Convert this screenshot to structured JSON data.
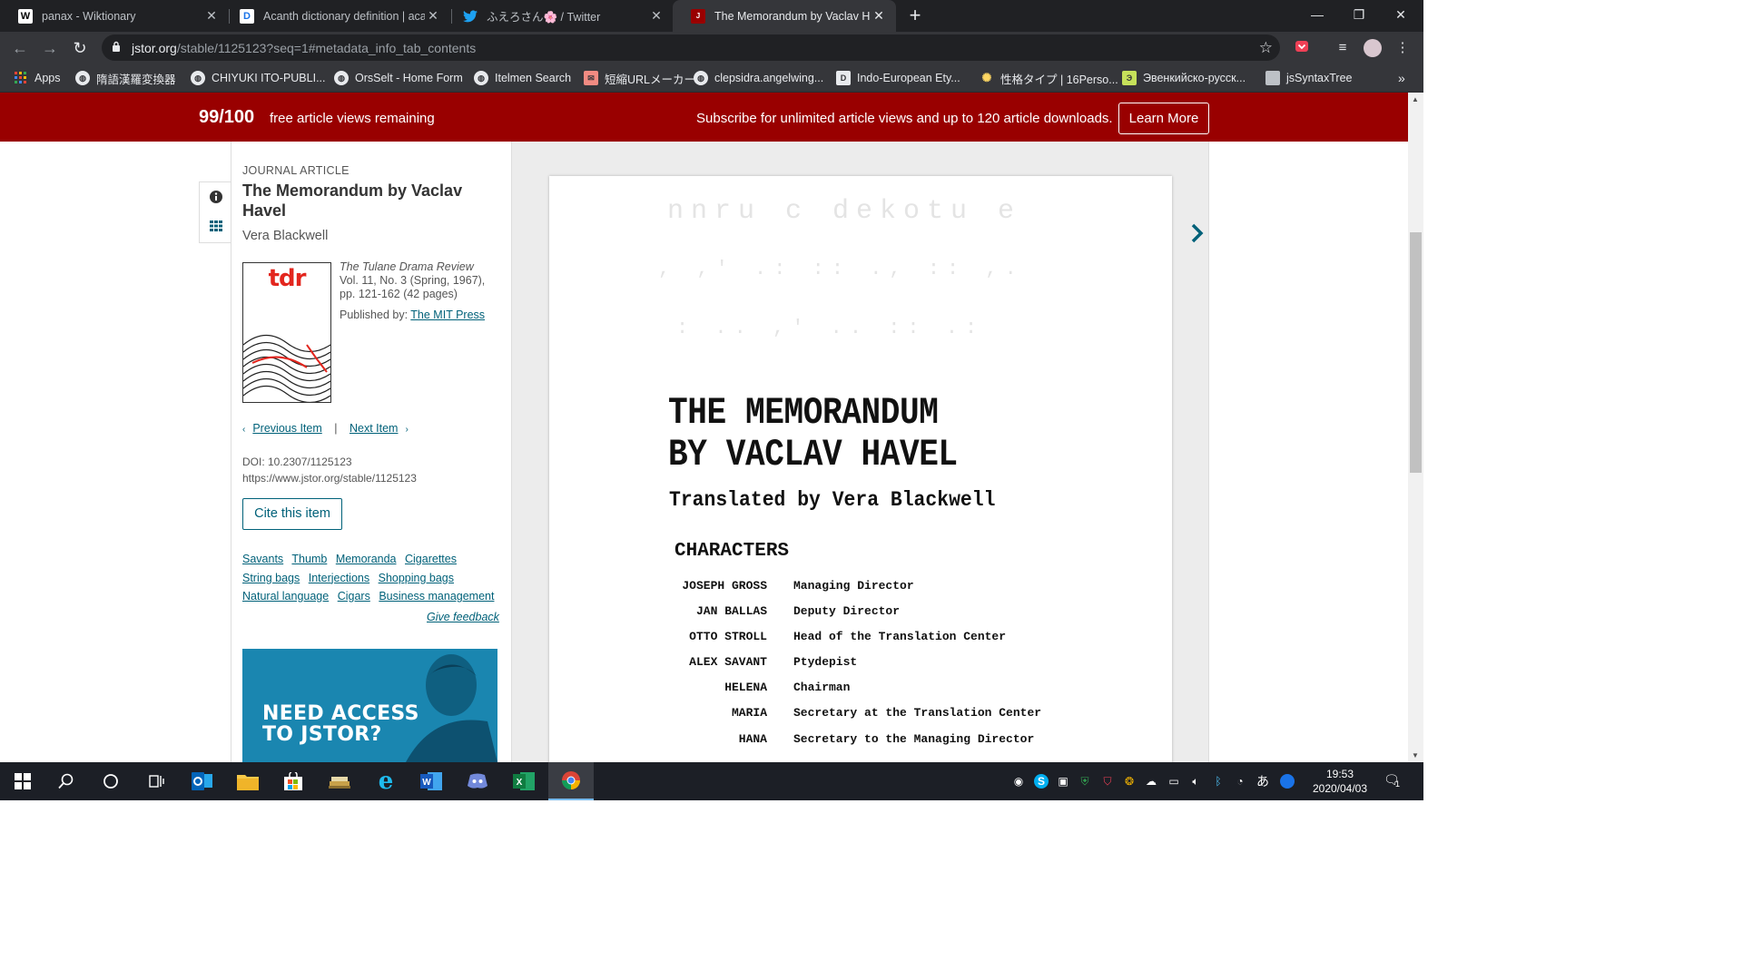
{
  "browser": {
    "tabs": [
      {
        "title": "panax - Wiktionary",
        "favicon": "W",
        "active": false
      },
      {
        "title": "Acanth dictionary definition | aca",
        "favicon": "D",
        "active": false
      },
      {
        "title": "ふえろさん🌸 / Twitter",
        "favicon": "twitter-bird",
        "active": false
      },
      {
        "title": "The Memorandum by Vaclav Hav",
        "favicon": "jstor",
        "active": true
      }
    ],
    "new_tab": "+",
    "url_domain": "jstor.org",
    "url_path": "/stable/1125123?seq=1#metadata_info_tab_contents",
    "bookmarks": [
      {
        "label": "Apps",
        "icon": "apps-grid-icon",
        "color": "#ea4335"
      },
      {
        "label": "隋語漢羅変換器",
        "icon": "globe-icon",
        "color": "#e8eaed"
      },
      {
        "label": "CHIYUKI ITO-PUBLI...",
        "icon": "globe-icon",
        "color": "#e8eaed"
      },
      {
        "label": "OrsSelt - Home Form",
        "icon": "globe-icon",
        "color": "#e8eaed"
      },
      {
        "label": "Itelmen Search",
        "icon": "globe-icon",
        "color": "#e8eaed"
      },
      {
        "label": "短縮URLメーカー",
        "icon": "url-icon",
        "color": "#f28b82"
      },
      {
        "label": "clepsidra.angelwing...",
        "icon": "globe-icon",
        "color": "#e8eaed"
      },
      {
        "label": "Indo-European Ety...",
        "icon": "d-icon",
        "color": "#e8eaed"
      },
      {
        "label": "性格タイプ | 16Perso...",
        "icon": "sparkle-icon",
        "color": "#fdd663"
      },
      {
        "label": "Эвенкийско-русск...",
        "icon": "e-icon",
        "color": "#c6e15a"
      },
      {
        "label": "jsSyntaxTree",
        "icon": "doc-icon",
        "color": "#bdc1c6"
      }
    ],
    "more_bookmarks": "»"
  },
  "banner": {
    "views": "99/100",
    "views_text": "free article views remaining",
    "subscribe_text": "Subscribe for unlimited article views and up to 120 article downloads.",
    "learn_more": "Learn More"
  },
  "article": {
    "type": "JOURNAL ARTICLE",
    "title": "The Memorandum by Vaclav Havel",
    "author": "Vera Blackwell",
    "journal": "The Tulane Drama Review",
    "volume": "Vol. 11, No. 3 (Spring, 1967),",
    "pages": "pp. 121-162 (42 pages)",
    "published_by_label": "Published by: ",
    "publisher": "The MIT Press",
    "previous_item": "Previous Item",
    "next_item": "Next Item",
    "separator": "|",
    "doi": "DOI: 10.2307/1125123",
    "stable_url": "https://www.jstor.org/stable/1125123",
    "cite_button": "Cite this item",
    "tags": [
      "Savants",
      "Thumb",
      "Memoranda",
      "Cigarettes",
      "String bags",
      "Interjections",
      "Shopping bags",
      "Natural language",
      "Cigars",
      "Business management"
    ],
    "give_feedback": "Give feedback",
    "cover_logo": "tdr",
    "ad_text_line1": "NEED ACCESS",
    "ad_text_line2": "TO JSTOR?"
  },
  "document": {
    "title_line1": "THE MEMORANDUM",
    "title_line2": "BY VACLAV HAVEL",
    "subtitle": "Translated by Vera Blackwell",
    "characters_heading": "CHARACTERS",
    "characters": [
      {
        "name": "JOSEPH GROSS",
        "role": "Managing Director"
      },
      {
        "name": "JAN BALLAS",
        "role": "Deputy Director"
      },
      {
        "name": "OTTO STROLL",
        "role": "Head of the Translation Center"
      },
      {
        "name": "ALEX SAVANT",
        "role": "Ptydepist"
      },
      {
        "name": "HELENA",
        "role": "Chairman"
      },
      {
        "name": "MARIA",
        "role": "Secretary at the Translation Center"
      },
      {
        "name": "HANA",
        "role": "Secretary to the Managing Director"
      }
    ]
  },
  "taskbar": {
    "time": "19:53",
    "date": "2020/04/03",
    "ime": "あ",
    "notification_count": "1"
  },
  "colors": {
    "banner_red": "#990000",
    "jstor_link": "#006179",
    "chrome_dark": "#202124",
    "chrome_toolbar": "#35363a"
  }
}
